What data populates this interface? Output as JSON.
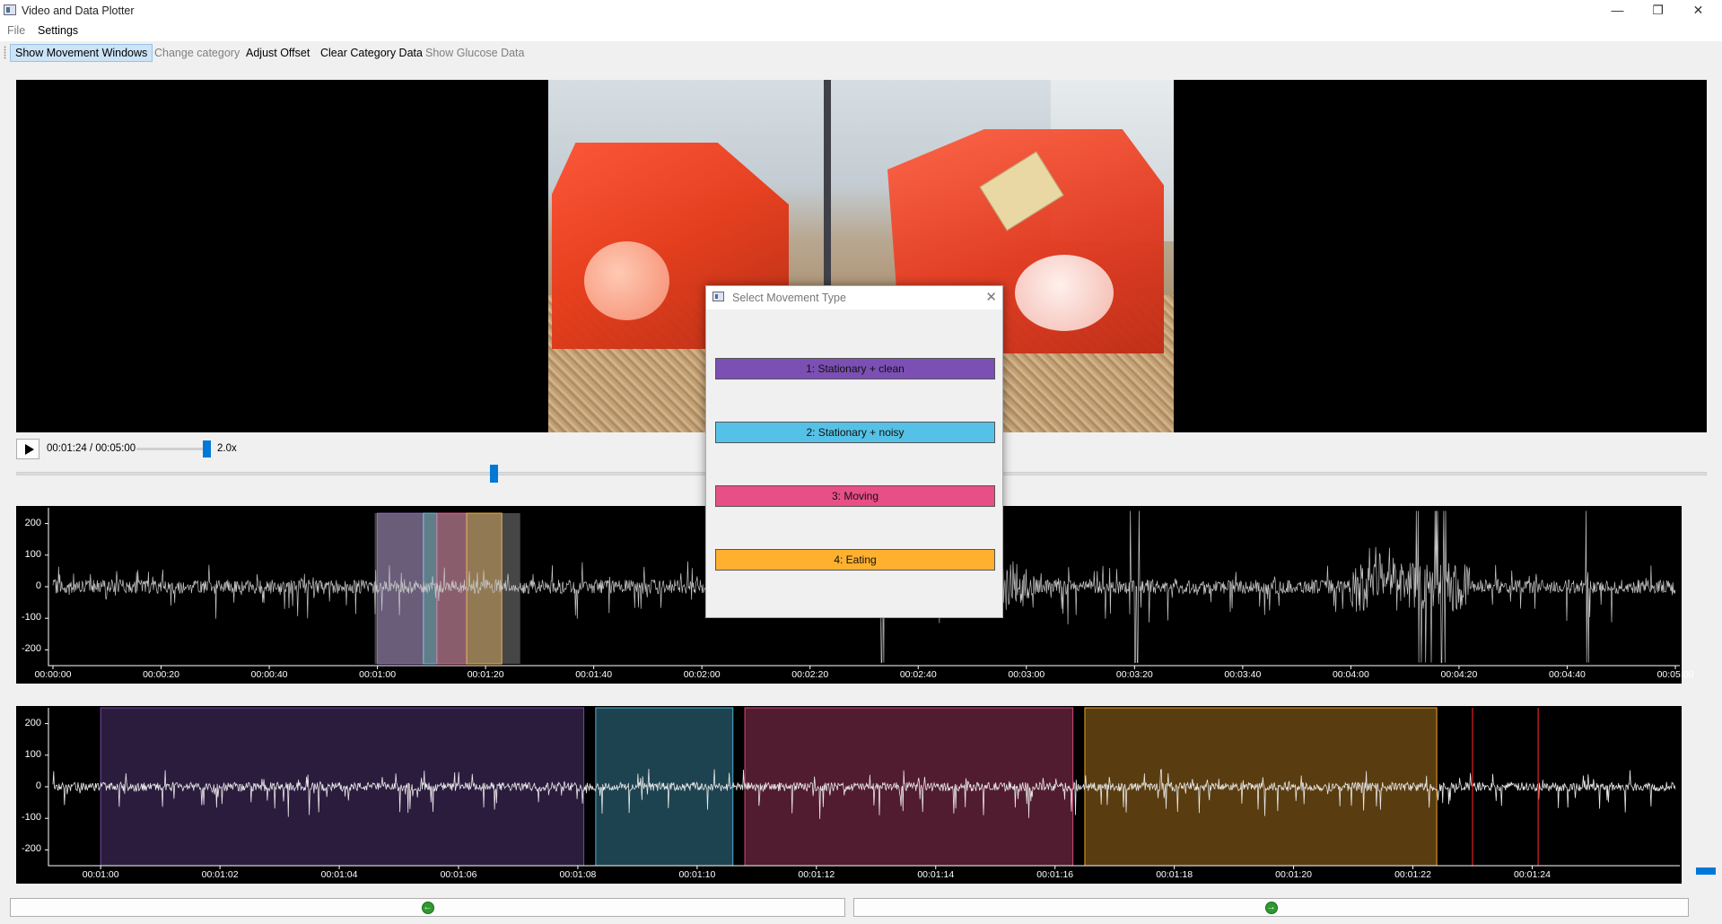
{
  "window": {
    "title": "Video and Data Plotter",
    "minimize": "—",
    "maximize": "❐",
    "close": "✕"
  },
  "menu": {
    "items": [
      "File",
      "Settings"
    ]
  },
  "toolbar": {
    "show_movement": "Show Movement Windows",
    "change_category": "Change category",
    "adjust_offset": "Adjust Offset",
    "clear_category": "Clear Category Data",
    "show_glucose": "Show Glucose Data"
  },
  "player": {
    "time": "00:01:24 / 00:05:00",
    "speed": "2.0x",
    "speed_fraction": 0.9,
    "seek_fraction": 0.28
  },
  "dialog": {
    "title": "Select Movement Type",
    "options": [
      {
        "label": "1: Stationary + clean",
        "color": "#7b4fb3"
      },
      {
        "label": "2: Stationary + noisy",
        "color": "#56c1e6"
      },
      {
        "label": "3: Moving",
        "color": "#e84f86"
      },
      {
        "label": "4: Eating",
        "color": "#ffb02e"
      }
    ]
  },
  "chart_data": [
    {
      "type": "line",
      "ylim": [
        -250,
        250
      ],
      "xlim_seconds": [
        0,
        300
      ],
      "yticks": [
        "200",
        "100",
        "0",
        "-100",
        "-200"
      ],
      "xticks": [
        "00:00:00",
        "00:00:20",
        "00:00:40",
        "00:01:00",
        "00:01:20",
        "00:01:40",
        "00:02:00",
        "00:02:20",
        "00:02:40",
        "00:03:00",
        "00:03:20",
        "00:03:40",
        "00:04:00",
        "00:04:20",
        "00:04:40",
        "00:05:00"
      ],
      "windows_seconds": [
        {
          "start": 60,
          "end": 68.5,
          "category": 1
        },
        {
          "start": 68.5,
          "end": 71,
          "category": 2
        },
        {
          "start": 71,
          "end": 76.5,
          "category": 3
        },
        {
          "start": 76.5,
          "end": 83,
          "category": 4
        }
      ]
    },
    {
      "type": "line",
      "ylim": [
        -250,
        250
      ],
      "xlim_seconds": [
        59.2,
        86.4
      ],
      "yticks": [
        "200",
        "100",
        "0",
        "-100",
        "-200"
      ],
      "xticks": [
        "00:01:00",
        "00:01:02",
        "00:01:04",
        "00:01:06",
        "00:01:08",
        "00:01:10",
        "00:01:12",
        "00:01:14",
        "00:01:16",
        "00:01:18",
        "00:01:20",
        "00:01:22",
        "00:01:24"
      ],
      "windows_seconds": [
        {
          "start": 60.0,
          "end": 68.1,
          "category": 1
        },
        {
          "start": 68.3,
          "end": 70.6,
          "category": 2
        },
        {
          "start": 70.8,
          "end": 76.3,
          "category": 3
        },
        {
          "start": 76.5,
          "end": 82.4,
          "category": 4
        }
      ],
      "markers_seconds": [
        83.0,
        84.1
      ]
    }
  ]
}
